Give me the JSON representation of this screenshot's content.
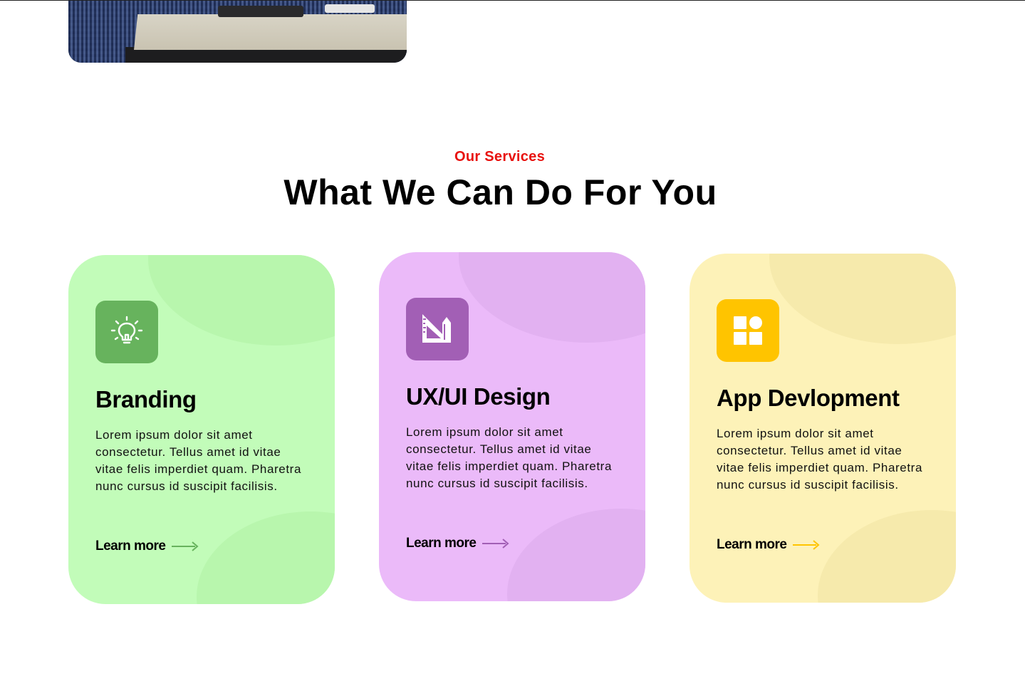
{
  "hero": {
    "image_alt": "Person at desk with devices"
  },
  "services": {
    "eyebrow": "Our Services",
    "title": "What We Can Do For You"
  },
  "cards": [
    {
      "title": "Branding",
      "text": "Lorem ipsum dolor sit amet consectetur. Tellus amet id vitae vitae felis imperdiet quam. Pharetra nunc cursus id suscipit facilisis.",
      "link_label": "Learn more",
      "icon": "lightbulb-icon",
      "accent": "#67b35d"
    },
    {
      "title": "UX/UI Design",
      "text": "Lorem ipsum dolor sit amet consectetur. Tellus amet id vitae vitae felis imperdiet quam. Pharetra nunc cursus id suscipit facilisis.",
      "link_label": "Learn more",
      "icon": "design-tools-icon",
      "accent": "#a25fb5"
    },
    {
      "title": "App Devlopment",
      "text": "Lorem ipsum dolor sit amet consectetur. Tellus amet id vitae vitae felis imperdiet quam. Pharetra nunc cursus id suscipit facilisis.",
      "link_label": "Learn more",
      "icon": "apps-grid-icon",
      "accent": "#ffc400"
    }
  ],
  "colors": {
    "eyebrow": "#e8110e",
    "green_card": "#c2fcb9",
    "purple_card": "#ebbaf9",
    "yellow_card": "#fdf2b8"
  }
}
